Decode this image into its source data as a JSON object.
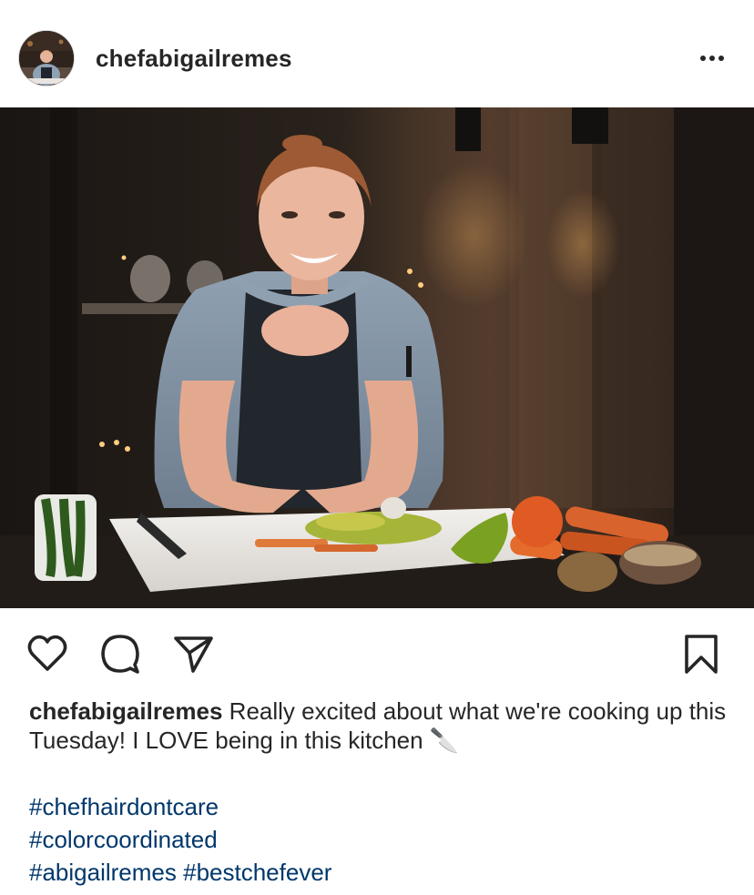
{
  "post": {
    "username": "chefabigailremes",
    "more_label": "More options",
    "image_alt": "Chef smiling in a kitchen behind a cutting board with chopped vegetables"
  },
  "actions": {
    "like_icon": "heart-icon",
    "comment_icon": "comment-icon",
    "share_icon": "paper-plane-icon",
    "save_icon": "bookmark-icon"
  },
  "caption": {
    "username": "chefabigailremes",
    "text": "Really excited about what we're cooking up this Tuesday! I LOVE being in this kitchen",
    "emoji": "🔪",
    "hashtags": [
      "#chefhairdontcare",
      "#colorcoordinated",
      "#abigailremes",
      "#bestchefever"
    ]
  },
  "colors": {
    "text": "#262626",
    "hashtag": "#00376b",
    "background": "#ffffff"
  }
}
